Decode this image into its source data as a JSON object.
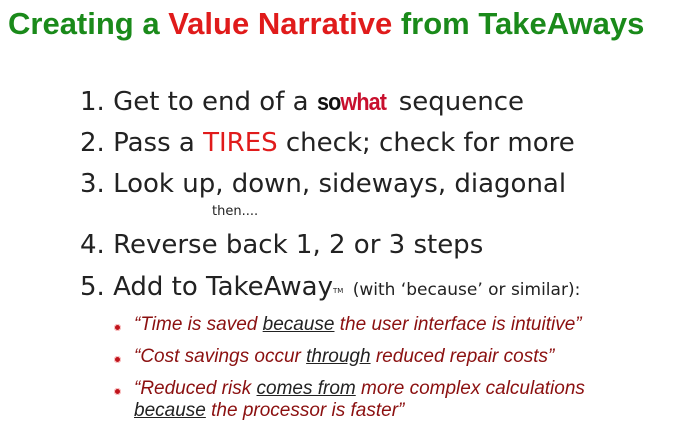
{
  "title": {
    "part1": "Creating a ",
    "part2": "Value Narrative",
    "part3": " from TakeAways"
  },
  "steps": [
    {
      "num": "1.",
      "pre": "Get to end of a ",
      "logo_so": "so",
      "logo_what": "what",
      "post": " sequence"
    },
    {
      "num": "2.",
      "pre": "Pass a ",
      "red": "TIRES",
      "post": " check; check for more"
    },
    {
      "num": "3.",
      "text": "Look up, down, sideways, diagonal"
    },
    {
      "num": "4.",
      "text": "Reverse back 1, 2 or 3 steps"
    },
    {
      "num": "5.",
      "pre": "Add to TakeAway",
      "tm": "TM",
      "post": " (with ‘because’ or similar):"
    }
  ],
  "then_note": "then....",
  "bullets": [
    {
      "q1": "“",
      "a": "Time is saved ",
      "u": "because",
      "b": " the user interface is intuitive”"
    },
    {
      "q1": "“",
      "a": "Cost savings occur ",
      "u": "through",
      "b": " reduced repair costs”"
    },
    {
      "q1": "“",
      "a": "Reduced risk ",
      "u": "comes from",
      "b": " more complex calculations",
      "u2": "because",
      "c": " the processor is faster”"
    }
  ]
}
